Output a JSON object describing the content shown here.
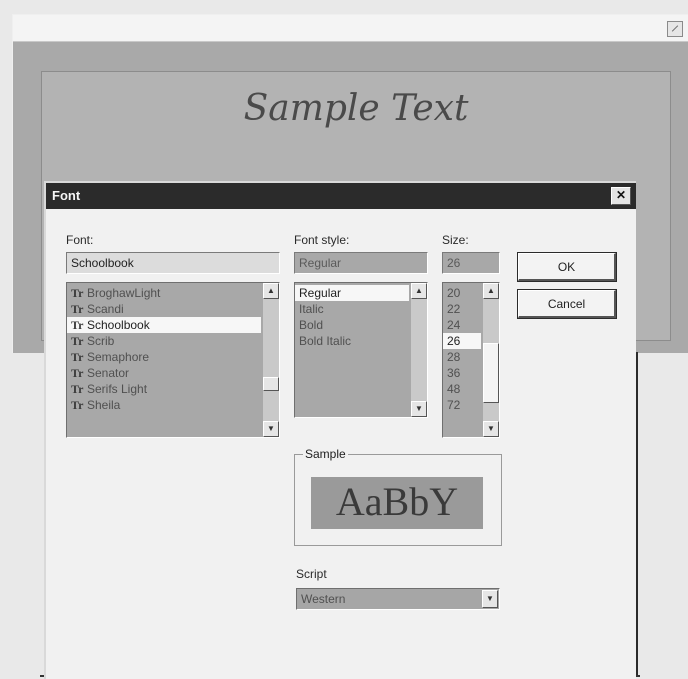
{
  "background_window": {
    "sample_text": "Sample Text"
  },
  "dialog": {
    "title": "Font",
    "close_glyph": "✕",
    "font": {
      "label": "Font:",
      "value": "Schoolbook",
      "items": [
        "BroghawLight",
        "Scandi",
        "Schoolbook",
        "Scrib",
        "Semaphore",
        "Senator",
        "Serifs Light",
        "Sheila"
      ],
      "selected_index": 2
    },
    "font_style": {
      "label": "Font style:",
      "value": "Regular",
      "items": [
        "Regular",
        "Italic",
        "Bold",
        "Bold Italic"
      ],
      "selected_index": 0
    },
    "size": {
      "label": "Size:",
      "value": "26",
      "items": [
        "20",
        "22",
        "24",
        "26",
        "28",
        "36",
        "48",
        "72"
      ],
      "selected_index": 3
    },
    "ok_label": "OK",
    "cancel_label": "Cancel",
    "sample": {
      "label": "Sample",
      "preview_text": "AaBbY"
    },
    "script": {
      "label": "Script",
      "value": "Western"
    }
  },
  "icons": {
    "truetype": "truetype-font-icon",
    "arrow_up": "scroll-up-icon",
    "arrow_down": "scroll-down-icon"
  }
}
